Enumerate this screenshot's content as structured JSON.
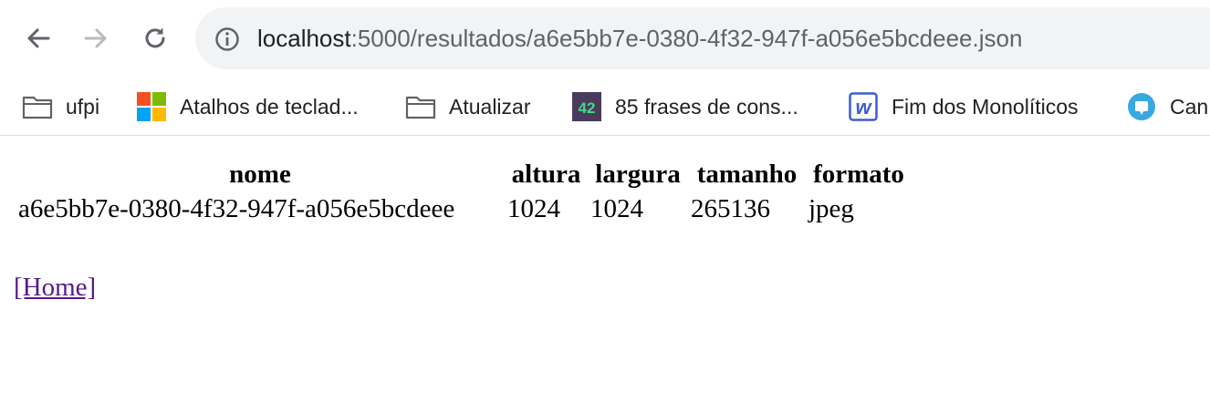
{
  "browser": {
    "url_host": "localhost",
    "url_path": ":5000/resultados/a6e5bb7e-0380-4f32-947f-a056e5bcdeee.json"
  },
  "bookmarks": [
    {
      "label": "ufpi",
      "icon": "folder-icon"
    },
    {
      "label": "Atalhos de teclad...",
      "icon": "microsoft-logo-icon"
    },
    {
      "label": "Atualizar",
      "icon": "folder-icon"
    },
    {
      "label": "85 frases de cons...",
      "icon": "badge-42-icon",
      "badge_text": "42"
    },
    {
      "label": "Fim dos Monolíticos",
      "icon": "w-logo-icon",
      "badge_text": "w"
    },
    {
      "label": "Can",
      "icon": "round-app-icon"
    }
  ],
  "table": {
    "headers": [
      "nome",
      "altura",
      "largura",
      "tamanho",
      "formato"
    ],
    "rows": [
      [
        "a6e5bb7e-0380-4f32-947f-a056e5bcdeee",
        "1024",
        "1024",
        "265136",
        "jpeg"
      ]
    ]
  },
  "home_link": "[Home]",
  "colors": {
    "link_visited": "#551a8b",
    "omnibox_bg": "#f1f3f4",
    "badge_42_bg": "#4a3a5c",
    "badge_42_text": "#3ddc84",
    "w_logo": "#3b5bdb",
    "round_app": "#3aa8e0"
  }
}
